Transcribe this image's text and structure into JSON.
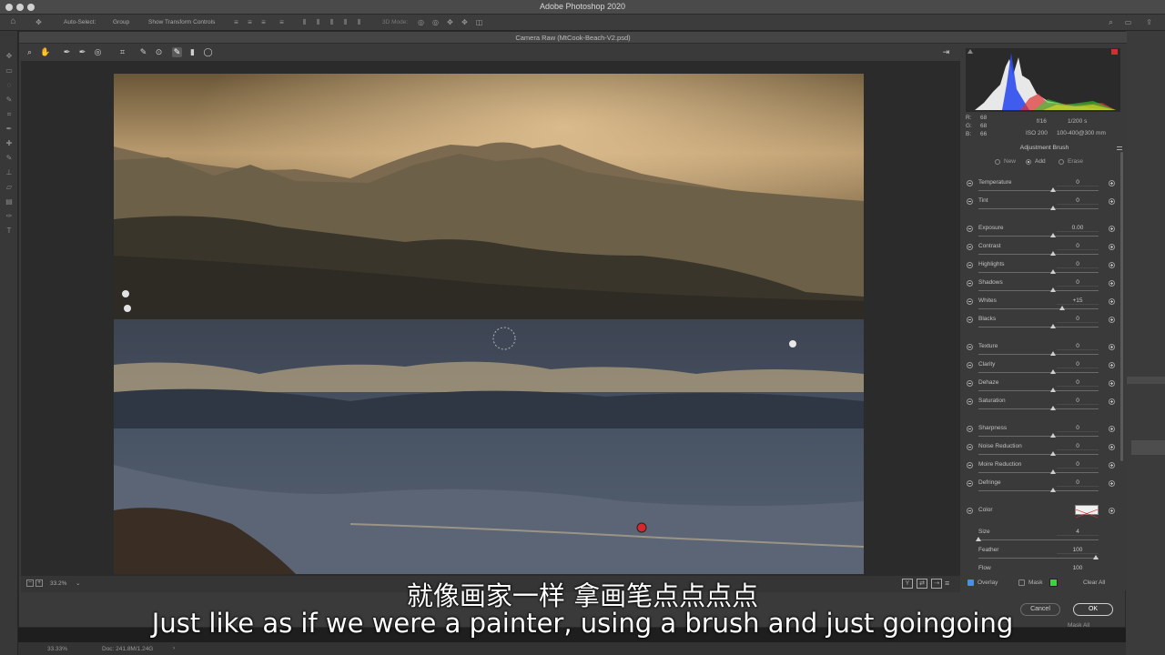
{
  "app": {
    "title": "Adobe Photoshop 2020"
  },
  "options_bar": {
    "auto_select": "Auto-Select:",
    "group": "Group",
    "show_transform": "Show Transform Controls",
    "mode_3d": "3D Mode:"
  },
  "dialog": {
    "title": "Camera Raw (MtCook-Beach-V2.psd)"
  },
  "readout": {
    "r": "R:",
    "g": "G:",
    "b": "B:",
    "r_val": "68",
    "g_val": "68",
    "b_val": "66",
    "aperture": "f/16",
    "shutter": "1/200 s",
    "iso": "ISO 200",
    "lens": "100-400@300 mm"
  },
  "panel": {
    "title": "Adjustment Brush",
    "modes": [
      "New",
      "Add",
      "Erase"
    ],
    "selected_mode": "Add",
    "sliders_group1": [
      {
        "label": "Temperature",
        "value": "0"
      },
      {
        "label": "Tint",
        "value": "0"
      }
    ],
    "sliders_group2": [
      {
        "label": "Exposure",
        "value": "0.00"
      },
      {
        "label": "Contrast",
        "value": "0"
      },
      {
        "label": "Highlights",
        "value": "0"
      },
      {
        "label": "Shadows",
        "value": "0"
      },
      {
        "label": "Whites",
        "value": "+15"
      },
      {
        "label": "Blacks",
        "value": "0"
      }
    ],
    "sliders_group3": [
      {
        "label": "Texture",
        "value": "0"
      },
      {
        "label": "Clarity",
        "value": "0"
      },
      {
        "label": "Dehaze",
        "value": "0"
      },
      {
        "label": "Saturation",
        "value": "0"
      }
    ],
    "sliders_group4": [
      {
        "label": "Sharpness",
        "value": "0"
      },
      {
        "label": "Noise Reduction",
        "value": "0"
      },
      {
        "label": "Moire Reduction",
        "value": "0"
      },
      {
        "label": "Defringe",
        "value": "0"
      }
    ],
    "color_label": "Color",
    "brush": [
      {
        "label": "Size",
        "value": "4"
      },
      {
        "label": "Feather",
        "value": "100"
      },
      {
        "label": "Flow",
        "value": "100"
      }
    ],
    "overlay": "Overlay",
    "mask": "Mask",
    "clear_all": "Clear All"
  },
  "bottom": {
    "zoom": "33.2%"
  },
  "buttons": {
    "cancel": "Cancel",
    "ok": "OK",
    "mask_all": "Mask All"
  },
  "ps_status": {
    "zoom": "33.33%",
    "doc": "Doc: 241.8M/1.24G"
  },
  "subtitles": {
    "cn": "就像画家一样 拿画笔点点点点",
    "en": "Just like as if we were a painter, using a brush and just goingoing"
  },
  "colors": {
    "accent_green": "#3fd13f",
    "pin_red": "#d8262e"
  }
}
